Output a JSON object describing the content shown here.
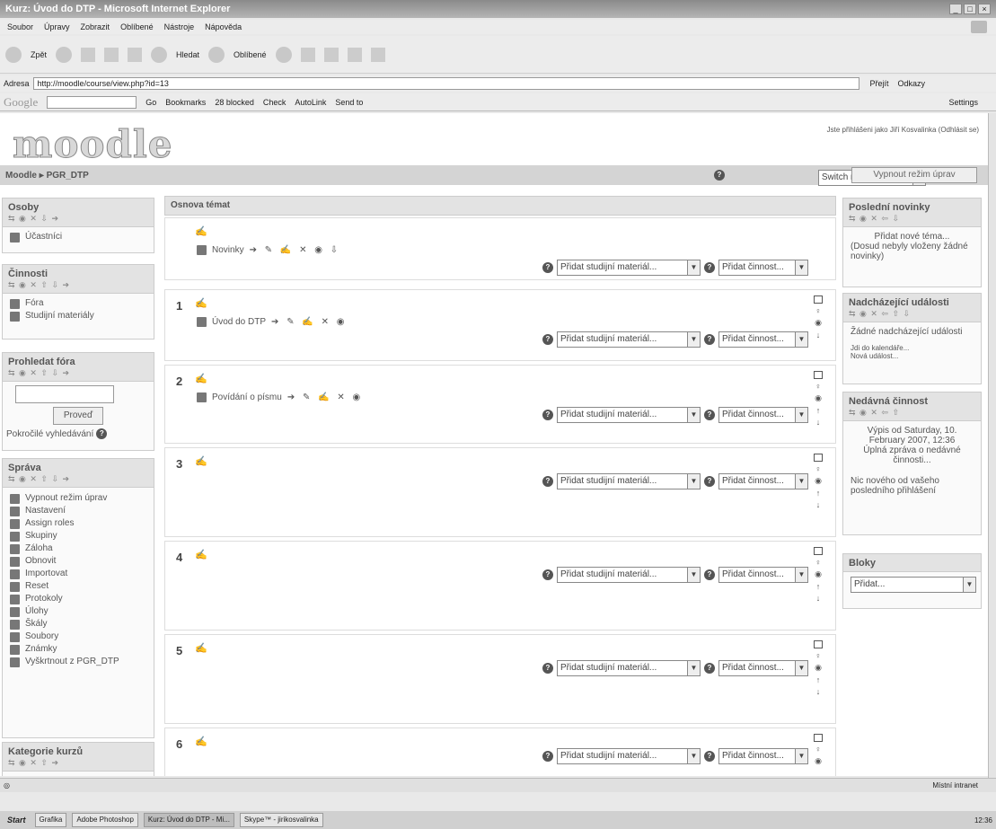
{
  "window": {
    "title": "Kurz: Úvod do DTP - Microsoft Internet Explorer"
  },
  "menu": [
    "Soubor",
    "Úpravy",
    "Zobrazit",
    "Oblíbené",
    "Nástroje",
    "Nápověda"
  ],
  "toolbar": {
    "back": "Zpět",
    "search": "Hledat",
    "favorites": "Oblíbené"
  },
  "address": {
    "label": "Adresa",
    "url": "http://moodle/course/view.php?id=13",
    "go": "Přejít",
    "links": "Odkazy"
  },
  "googlebar": {
    "logo": "Google",
    "go": "Go",
    "bookmarks": "Bookmarks",
    "blocked": "28 blocked",
    "check": "Check",
    "autolink": "AutoLink",
    "sendto": "Send to",
    "settings": "Settings"
  },
  "header": {
    "logo": "moodle",
    "login_info": "Jste přihlášeni jako Jiří Kosvalinka (Odhlásit se)"
  },
  "navbar": {
    "breadcrumb": "Moodle ▸ PGR_DTP",
    "switch_role": "Switch role to...",
    "edit_toggle": "Vypnout režim úprav"
  },
  "left": {
    "osoby": {
      "title": "Osoby",
      "items": [
        "Účastníci"
      ]
    },
    "cinnosti": {
      "title": "Činnosti",
      "items": [
        "Fóra",
        "Studijní materiály"
      ]
    },
    "hledat": {
      "title": "Prohledat fóra",
      "button": "Proveď",
      "advanced": "Pokročilé vyhledávání"
    },
    "sprava": {
      "title": "Správa",
      "items": [
        "Vypnout režim úprav",
        "Nastavení",
        "Assign roles",
        "Skupiny",
        "Záloha",
        "Obnovit",
        "Importovat",
        "Reset",
        "Protokoly",
        "Úlohy",
        "Škály",
        "Soubory",
        "Známky",
        "Vyškrtnout z PGR_DTP"
      ]
    },
    "kategorie": {
      "title": "Kategorie kurzů"
    }
  },
  "main": {
    "heading": "Osnova témat",
    "add_material": "Přidat studijní materiál...",
    "add_activity": "Přidat činnost...",
    "sections": [
      {
        "num": "",
        "resource": "Novinky"
      },
      {
        "num": "1",
        "resource": "Úvod do DTP"
      },
      {
        "num": "2",
        "resource": "Povídání o písmu"
      },
      {
        "num": "3",
        "resource": ""
      },
      {
        "num": "4",
        "resource": ""
      },
      {
        "num": "5",
        "resource": ""
      },
      {
        "num": "6",
        "resource": ""
      }
    ]
  },
  "right": {
    "novinky": {
      "title": "Poslední novinky",
      "add": "Přidat nové téma...",
      "none": "(Dosud nebyly vloženy žádné novinky)"
    },
    "udalosti": {
      "title": "Nadcházející události",
      "none": "Žádné nadcházející události",
      "link1": "Jdi do kalendáře...",
      "link2": "Nová událost..."
    },
    "cinnost": {
      "title": "Nedávná činnost",
      "since": "Výpis od Saturday, 10. February 2007, 12:36",
      "full": "Úplná zpráva o nedávné činnosti...",
      "nothing": "Nic nového od vašeho posledního přihlášení"
    },
    "bloky": {
      "title": "Bloky",
      "add": "Přidat..."
    }
  },
  "status": {
    "zone": "Místní intranet"
  },
  "taskbar": {
    "start": "Start",
    "tasks": [
      "Grafika",
      "Adobe Photoshop",
      "Kurz: Úvod do DTP - Mi...",
      "Skype™ - jirikosvalinka"
    ],
    "clock": "12:36"
  }
}
